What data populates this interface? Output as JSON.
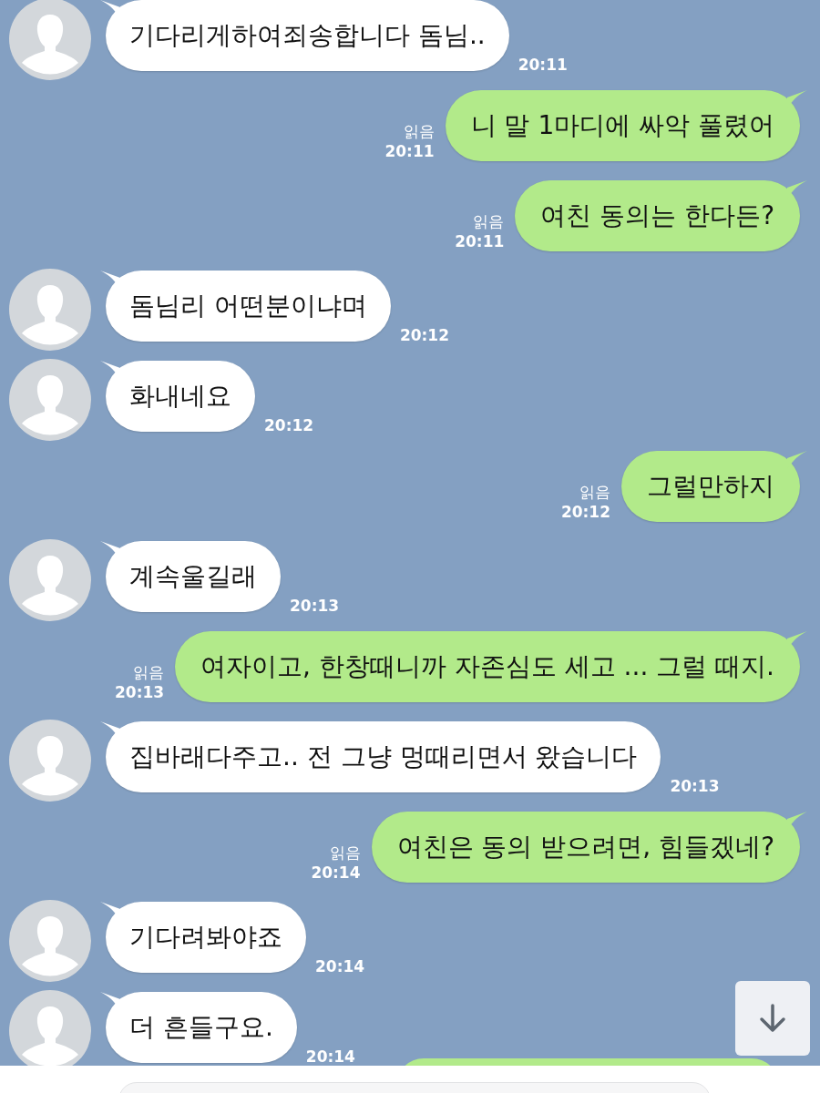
{
  "messages": [
    {
      "kind": "received",
      "text": "기다리게하여죄송합니다 돔님..",
      "time": "20:11"
    },
    {
      "kind": "sent",
      "text": "니 말 1마디에 싸악 풀렸어",
      "read": "읽음",
      "time": "20:11"
    },
    {
      "kind": "sent",
      "text": "여친 동의는 한다든?",
      "read": "읽음",
      "time": "20:11"
    },
    {
      "kind": "received",
      "text": "돔님리 어떤분이냐며",
      "time": "20:12"
    },
    {
      "kind": "received",
      "text": "화내네요",
      "time": "20:12"
    },
    {
      "kind": "sent",
      "text": "그럴만하지",
      "read": "읽음",
      "time": "20:12"
    },
    {
      "kind": "received",
      "text": "계속울길래",
      "time": "20:13"
    },
    {
      "kind": "sent",
      "text": "여자이고, 한창때니까 자존심도 세고 ... 그럴 때지.",
      "read": "읽음",
      "time": "20:13"
    },
    {
      "kind": "received",
      "text": "집바래다주고.. 전 그냥 멍때리면서 왔습니다",
      "time": "20:13"
    },
    {
      "kind": "sent",
      "text": "여친은 동의 받으려면, 힘들겠네?",
      "read": "읽음",
      "time": "20:14"
    },
    {
      "kind": "received",
      "text": "기다려봐야죠",
      "time": "20:14"
    },
    {
      "kind": "received",
      "text": "더 흔들구요.",
      "time": "20:14"
    }
  ]
}
